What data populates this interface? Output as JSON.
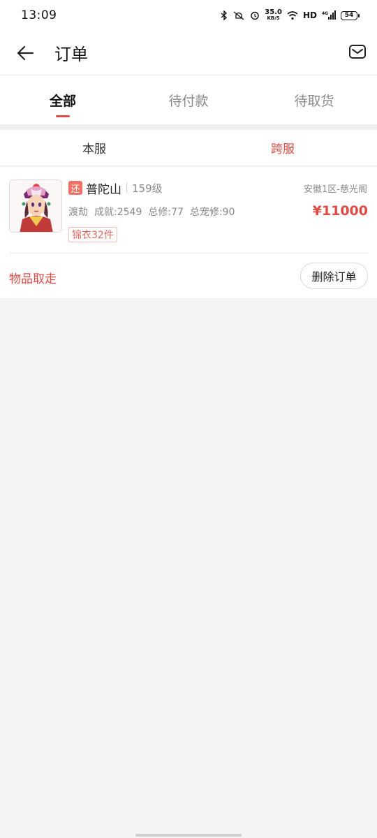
{
  "status_bar": {
    "time": "13:09",
    "net_speed_value": "35.0",
    "net_speed_unit": "KB/S",
    "hd_label": "HD",
    "signal_label": "4G",
    "battery_level": "54"
  },
  "header": {
    "title": "订单"
  },
  "tabs": [
    {
      "label": "全部",
      "active": true
    },
    {
      "label": "待付款",
      "active": false
    },
    {
      "label": "待取货",
      "active": false
    }
  ],
  "server_tabs": [
    {
      "label": "本服",
      "active": false
    },
    {
      "label": "跨服",
      "active": true
    }
  ],
  "order": {
    "badge": "还",
    "server_name": "普陀山",
    "level": "159级",
    "region": "安徽1区-慈光阁",
    "stats": [
      "渡劫",
      "成就:2549",
      "总修:77",
      "总宠修:90"
    ],
    "price": "¥11000",
    "tag": "锦衣32件",
    "status": "物品取走",
    "delete_label": "删除订单"
  },
  "colors": {
    "accent": "#e04a44",
    "badge_bg": "#f07066",
    "background": "#f4f4f4"
  }
}
